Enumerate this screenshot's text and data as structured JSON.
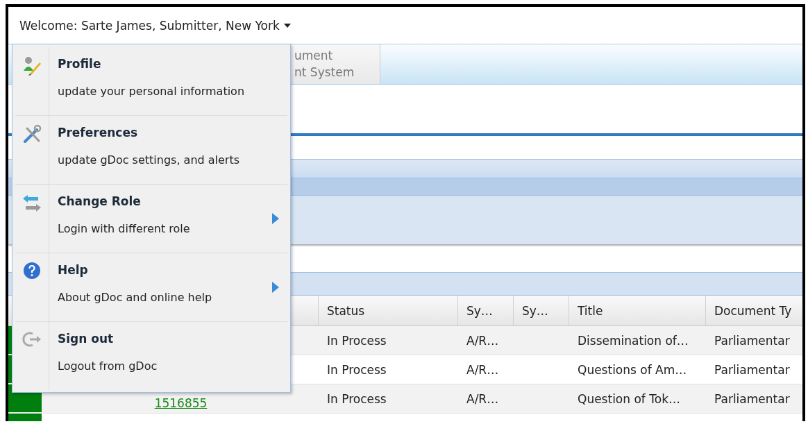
{
  "header": {
    "welcome": "Welcome: Sarte James, Submitter, New York"
  },
  "tab": {
    "lines": [
      "ument",
      "nt System"
    ]
  },
  "user_menu": {
    "items": [
      {
        "kind": "profile",
        "title": "Profile",
        "description": "update your personal information",
        "submenu": false
      },
      {
        "kind": "preferences",
        "title": "Preferences",
        "description": "update gDoc settings, and alerts",
        "submenu": false
      },
      {
        "kind": "change_role",
        "title": "Change Role",
        "description": "Login with different role",
        "submenu": true
      },
      {
        "kind": "help",
        "title": "Help",
        "description": "About gDoc and online help",
        "submenu": true
      },
      {
        "kind": "sign_out",
        "title": "Sign out",
        "description": "Logout from gDoc",
        "submenu": false
      }
    ]
  },
  "table": {
    "columns": [
      "",
      "Status",
      "Sy…",
      "Sy…",
      "Title",
      "Document Ty"
    ],
    "rows": [
      {
        "color": "#007f0e",
        "cells": [
          "",
          "In Process",
          "A/R…",
          "",
          "Dissemination of…",
          "Parliamentar"
        ]
      },
      {
        "color": "#007f0e",
        "cells": [
          "",
          "In Process",
          "A/R…",
          "",
          "Questions of Am…",
          "Parliamentar"
        ]
      },
      {
        "color": "#007f0e",
        "cells": [
          "1516855",
          "In Process",
          "A/R…",
          "",
          "Question of Tok…",
          "Parliamentar"
        ]
      },
      {
        "color": "#007f0e",
        "cells": [
          "",
          "",
          "",
          "",
          "",
          ""
        ]
      }
    ]
  }
}
